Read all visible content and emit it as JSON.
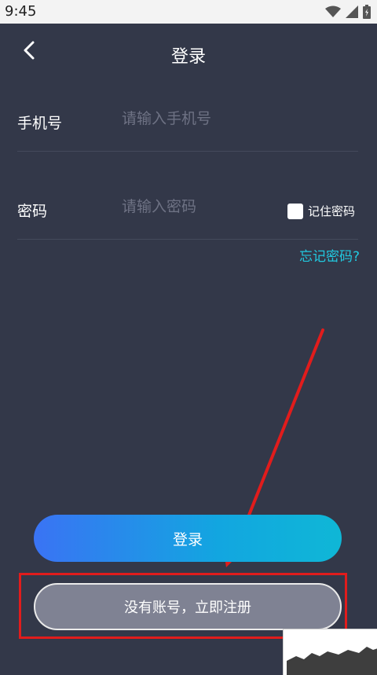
{
  "status_bar": {
    "time": "9:45",
    "icons": [
      "wifi-icon",
      "signal-icon",
      "battery-icon"
    ]
  },
  "header": {
    "back_icon": "chevron-left-icon",
    "title": "登录"
  },
  "form": {
    "phone": {
      "label": "手机号",
      "placeholder": "请输入手机号",
      "value": ""
    },
    "password": {
      "label": "密码",
      "placeholder": "请输入密码",
      "value": ""
    },
    "remember": {
      "label": "记住密码",
      "checked": false
    },
    "forgot_label": "忘记密码?"
  },
  "actions": {
    "login_label": "登录",
    "register_label": "没有账号，立即注册"
  },
  "colors": {
    "background": "#333849",
    "accent_link": "#21c9e0",
    "login_gradient_start": "#3a73f4",
    "login_gradient_end": "#0fb7d6",
    "register_bg": "#7f8293",
    "annotation_red": "#e11c1c"
  }
}
